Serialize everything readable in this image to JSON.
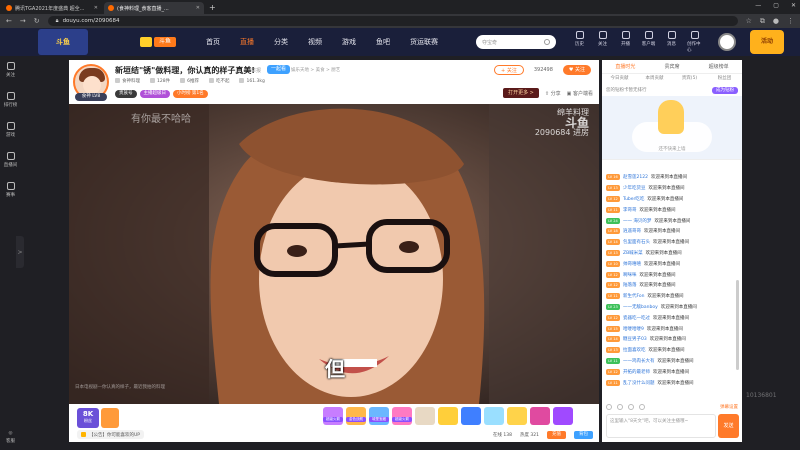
{
  "browser": {
    "tabs": [
      {
        "title": "腾讯TGA2021年度盛典 超全..."
      },
      {
        "title": "(食神料理_食客直播_..."
      }
    ],
    "new_tab": "+",
    "url": "douyu.com/2090684",
    "window_controls": [
      "—",
      "▢",
      "✕"
    ]
  },
  "header": {
    "badge": "斗鱼",
    "logo_text": "斗鱼",
    "nav": [
      "首页",
      "直播",
      "分类",
      "视频",
      "游戏",
      "鱼吧",
      "货运联赛"
    ],
    "active_nav": "直播",
    "search_placeholder": "夺宝奇",
    "icons": [
      {
        "label": "历史",
        "icon": "history-icon"
      },
      {
        "label": "关注",
        "icon": "follow-icon"
      },
      {
        "label": "开播",
        "icon": "live-icon"
      },
      {
        "label": "客户端",
        "icon": "client-icon"
      },
      {
        "label": "消息",
        "icon": "message-icon"
      },
      {
        "label": "创作中心",
        "icon": "creator-icon"
      }
    ],
    "promo": "活动"
  },
  "sidebar": {
    "items": [
      {
        "label": "关注",
        "icon": "heart-icon"
      },
      {
        "label": "排行榜",
        "icon": "rank-icon"
      },
      {
        "label": "游戏",
        "icon": "game-icon"
      },
      {
        "label": "直播间",
        "icon": "room-icon"
      },
      {
        "label": "赛事",
        "icon": "trophy-icon"
      }
    ],
    "toggle": ">",
    "bottom": "客服"
  },
  "room": {
    "title": "新垣结\"锈\"做料理，你认真的样子真美!",
    "report": "举报",
    "tag": "一起看",
    "crumb": "娱乐天地 > 美食 > 厨艺",
    "anchor_level": "食神 LV8",
    "meta": [
      "食神料理",
      "128件",
      "6推荐",
      "吃不起",
      "161.3kg"
    ],
    "badges": [
      "贵族号",
      "主播超级日",
      "小时榜 第1名"
    ],
    "subscribe": "+ 关注",
    "follow_count": "392498",
    "fans_btn": "♥ 关注",
    "gift_banner": "打开更多 >",
    "share": "分享",
    "client": "客户端看"
  },
  "video": {
    "watermark_left": "有你最不哈哈",
    "watermark_right_top": "绵羊料理",
    "watermark_right_logo": "斗鱼",
    "watermark_right_sub": "2090684 进房",
    "subtitle": "但",
    "caption": "日本电视剧—你认真的样子，最近我拍的料理"
  },
  "giftbar": {
    "fans_top": "粉丝",
    "fans_level": "8K",
    "gift_labels": [
      "超级火箭",
      "金色战舰",
      "城堡宝藏",
      "超级火箭"
    ],
    "notice": "【公告】你可能喜欢的UP",
    "viewers": "在线 138",
    "hot": "热度 321",
    "btn_orange": "充值",
    "btn_blue": "背包"
  },
  "rpanel": {
    "tabs": [
      "直播时光",
      "贵宾席",
      "超级榜单"
    ],
    "active_tab": "直播时光",
    "subtabs": [
      "今日贡献",
      "本周贡献",
      "贵宾(5)",
      "粉丝团"
    ],
    "rank_text": "您的钻粉卡暂无排行",
    "rank_btn": "成为钻粉",
    "art_text": "还不快来上墙",
    "chat": [
      {
        "lv": "LV 16",
        "name": "赵雪莲2122",
        "msg": "欢迎来到本直播间",
        "color": "#ff9a3a"
      },
      {
        "lv": "LV 13",
        "name": "少年吃货豆",
        "msg": "欢迎来到本直播间",
        "color": "#ff9a3a"
      },
      {
        "lv": "LV 12",
        "name": "Tuber吃吃",
        "msg": "欢迎来到本直播间",
        "color": "#ff9a3a"
      },
      {
        "lv": "LV 11",
        "name": "李哥哥",
        "msg": "欢迎来到本直播间",
        "color": "#ff9a3a"
      },
      {
        "lv": "LV 24",
        "name": "一一 海贝的梦",
        "msg": "欢迎来到本直播间",
        "color": "#3ec15a"
      },
      {
        "lv": "LV 18",
        "name": "逍遥哥哥",
        "msg": "欢迎来到本直播间",
        "color": "#ff9a3a"
      },
      {
        "lv": "LV 14",
        "name": "包里面有石头",
        "msg": "欢迎来到本直播间",
        "color": "#ff9a3a"
      },
      {
        "lv": "LV 13",
        "name": "ZB喊米菜",
        "msg": "欢迎来到本直播间",
        "color": "#ff9a3a"
      },
      {
        "lv": "LV 10",
        "name": "帅哥嘻嘻",
        "msg": "欢迎来到本直播间",
        "color": "#ff9a3a"
      },
      {
        "lv": "LV 12",
        "name": "啊咪咪",
        "msg": "欢迎来到本直播间",
        "color": "#ff9a3a"
      },
      {
        "lv": "LV 12",
        "name": "陆落落",
        "msg": "欢迎来到本直播间",
        "color": "#ff9a3a"
      },
      {
        "lv": "LV 11",
        "name": "新生代Fon",
        "msg": "欢迎来到本直播间",
        "color": "#ff9a3a"
      },
      {
        "lv": "LV 23",
        "name": "一一无敌banboy",
        "msg": "欢迎来到本直播间",
        "color": "#3ec15a"
      },
      {
        "lv": "LV 12",
        "name": "瓷器吃一吃过",
        "msg": "欢迎来到本直播间",
        "color": "#ff9a3a"
      },
      {
        "lv": "LV 15",
        "name": "哈喽哈喽9",
        "msg": "欢迎来到本直播间",
        "color": "#ff9a3a"
      },
      {
        "lv": "LV 14",
        "name": "糖豆男子03",
        "msg": "欢迎来到本直播间",
        "color": "#ff9a3a"
      },
      {
        "lv": "LV 13",
        "name": "拉面喜欢吃",
        "msg": "欢迎来到本直播间",
        "color": "#ff9a3a"
      },
      {
        "lv": "LV 11",
        "name": "一一鸡肉长大有",
        "msg": "欢迎来到本直播间",
        "color": "#3ec15a"
      },
      {
        "lv": "LV 12",
        "name": "开拓的最老师",
        "msg": "欢迎来到本直播间",
        "color": "#ff9a3a"
      },
      {
        "lv": "LV 11",
        "name": "乱了没什么问题",
        "msg": "欢迎来到本直播间",
        "color": "#ff9a3a"
      }
    ],
    "danmu_btn": "弹幕设置",
    "input_placeholder": "这里输入\"8天文\"吧，可以关注主播哦~",
    "send": "发送"
  },
  "corner_watermark": "10136801"
}
